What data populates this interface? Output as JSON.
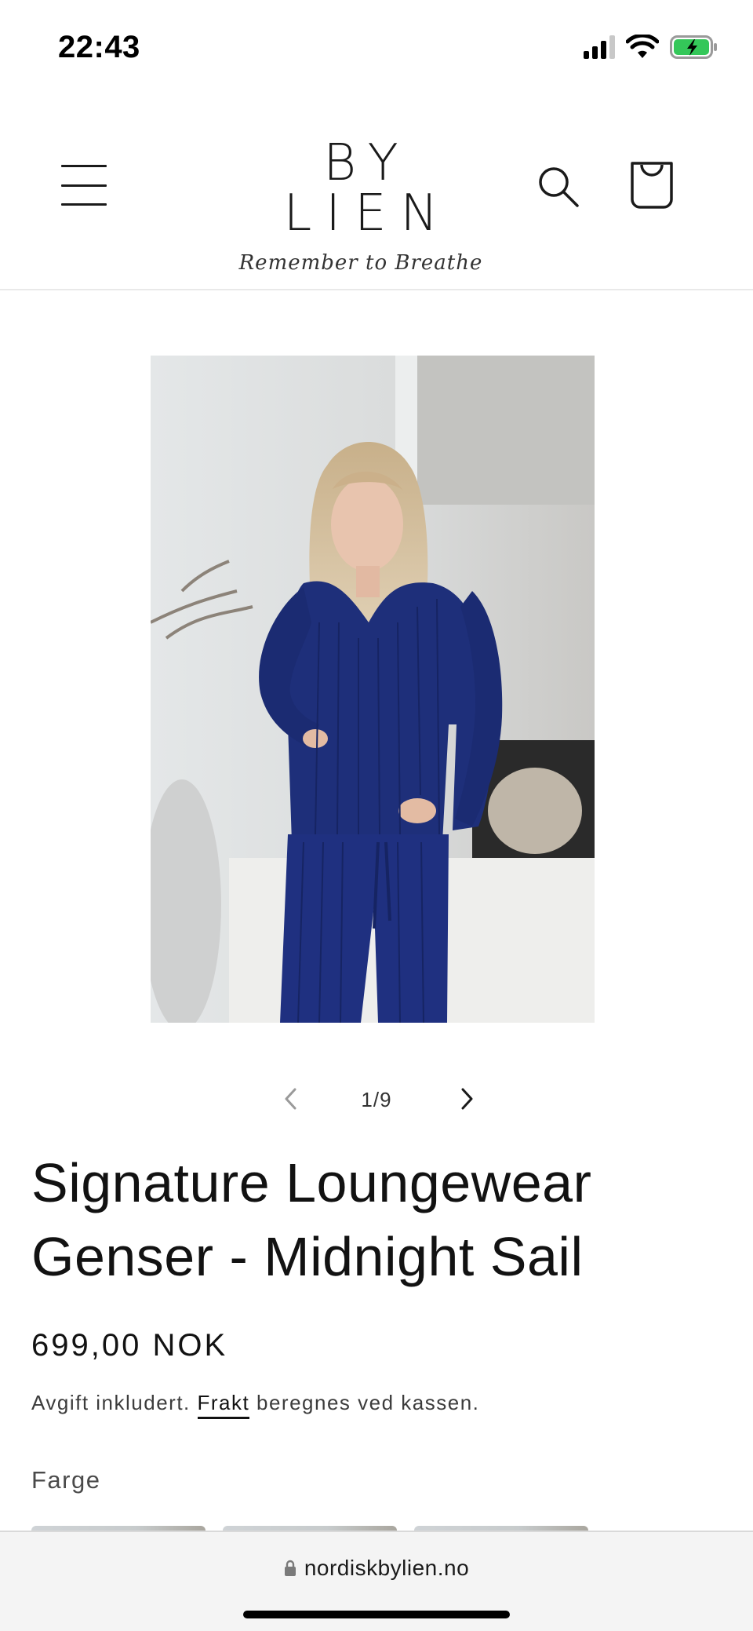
{
  "status_bar": {
    "time": "22:43",
    "icons": [
      "cellular-signal-icon",
      "wifi-icon",
      "battery-charging-icon"
    ]
  },
  "header": {
    "logo": "BY LIEN",
    "tagline": "Remember to Breathe",
    "icons": [
      "menu-icon",
      "search-icon",
      "cart-bag-icon"
    ]
  },
  "product": {
    "image_alt": "Woman wearing navy ribbed loungewear sweater and pants",
    "slider_counter": "1/9",
    "title": "Signature Loungewear Genser - Midnight Sail",
    "price": "699,00 NOK",
    "tax_note_prefix": "Avgift inkludert.",
    "shipping_link": "Frakt",
    "tax_note_suffix": "beregnes ved kassen.",
    "color_label": "Farge"
  },
  "browser": {
    "url": "nordiskbylien.no"
  },
  "colors": {
    "sweater_navy": "#1e2f7a",
    "text": "#121212",
    "battery_green": "#34c759"
  }
}
